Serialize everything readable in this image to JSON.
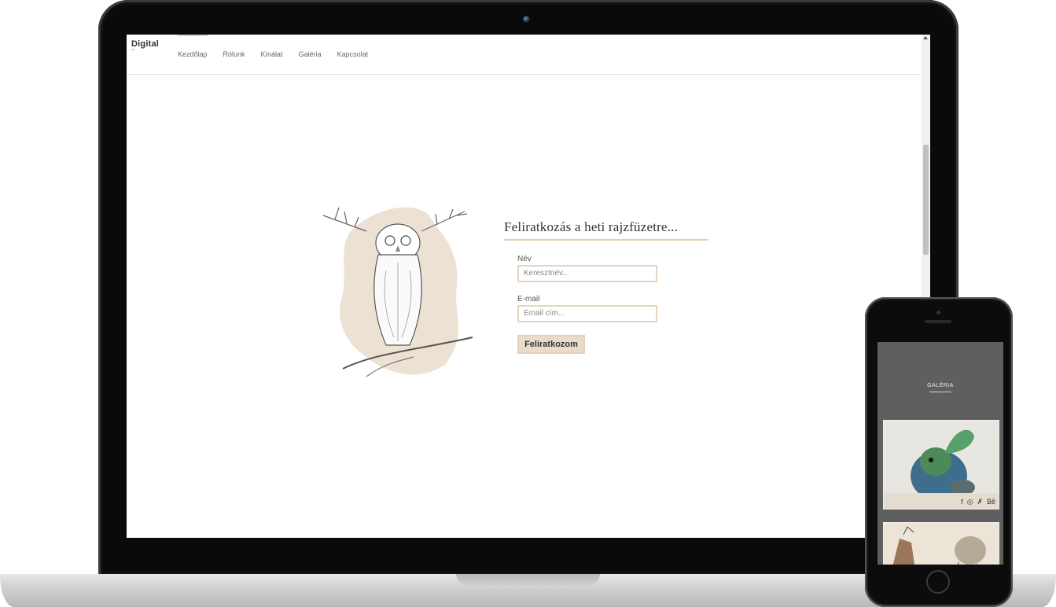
{
  "site": {
    "logo_text": "Digital",
    "logo_sub": "art"
  },
  "nav": {
    "items": [
      {
        "label": "Kezdőlap"
      },
      {
        "label": "Rólunk"
      },
      {
        "label": "Kínálat"
      },
      {
        "label": "Galéria"
      },
      {
        "label": "Kapcsolat"
      }
    ],
    "active_index": 0
  },
  "newsletter": {
    "title": "Feliratkozás a heti rajzfüzetre...",
    "name_label": "Név",
    "name_placeholder": "Keresztnév...",
    "email_label": "E-mail",
    "email_placeholder": "Email cím...",
    "submit_label": "Feliratkozom"
  },
  "phone": {
    "section_title": "GALÉRIA",
    "social_icons": [
      "facebook-icon",
      "instagram-icon",
      "deviantart-icon",
      "behance-icon"
    ],
    "social_glyphs": {
      "facebook": "f",
      "instagram": "◎",
      "deviantart": "✗",
      "behance": "Bē"
    }
  },
  "colors": {
    "accent": "#e4cdb4",
    "button_bg": "#e9dccb",
    "phone_bg": "#5f5f5f"
  }
}
